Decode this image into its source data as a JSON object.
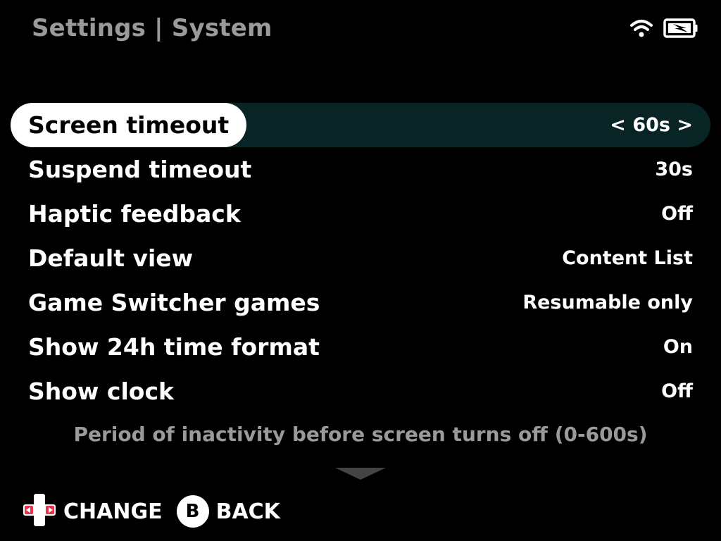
{
  "header": {
    "title": "Settings | System"
  },
  "status": {
    "wifi_icon": "wifi-icon",
    "battery_icon": "battery-charging-icon"
  },
  "settings": [
    {
      "label": "Screen timeout",
      "value": "< 60s >",
      "selected": true
    },
    {
      "label": "Suspend timeout",
      "value": "30s",
      "selected": false
    },
    {
      "label": "Haptic feedback",
      "value": "Off",
      "selected": false
    },
    {
      "label": "Default view",
      "value": "Content List",
      "selected": false
    },
    {
      "label": "Game Switcher games",
      "value": "Resumable only",
      "selected": false
    },
    {
      "label": "Show 24h time format",
      "value": "On",
      "selected": false
    },
    {
      "label": "Show clock",
      "value": "Off",
      "selected": false
    }
  ],
  "description": "Period of inactivity before screen turns off (0-600s)",
  "footer": {
    "change_label": "CHANGE",
    "b_button_label": "B",
    "back_label": "BACK"
  },
  "colors": {
    "background": "#000000",
    "selected_row_bg": "#082424",
    "selected_label_bg": "#ffffff",
    "muted_text": "#9a9a9a",
    "dpad_accent": "#e8324a"
  }
}
